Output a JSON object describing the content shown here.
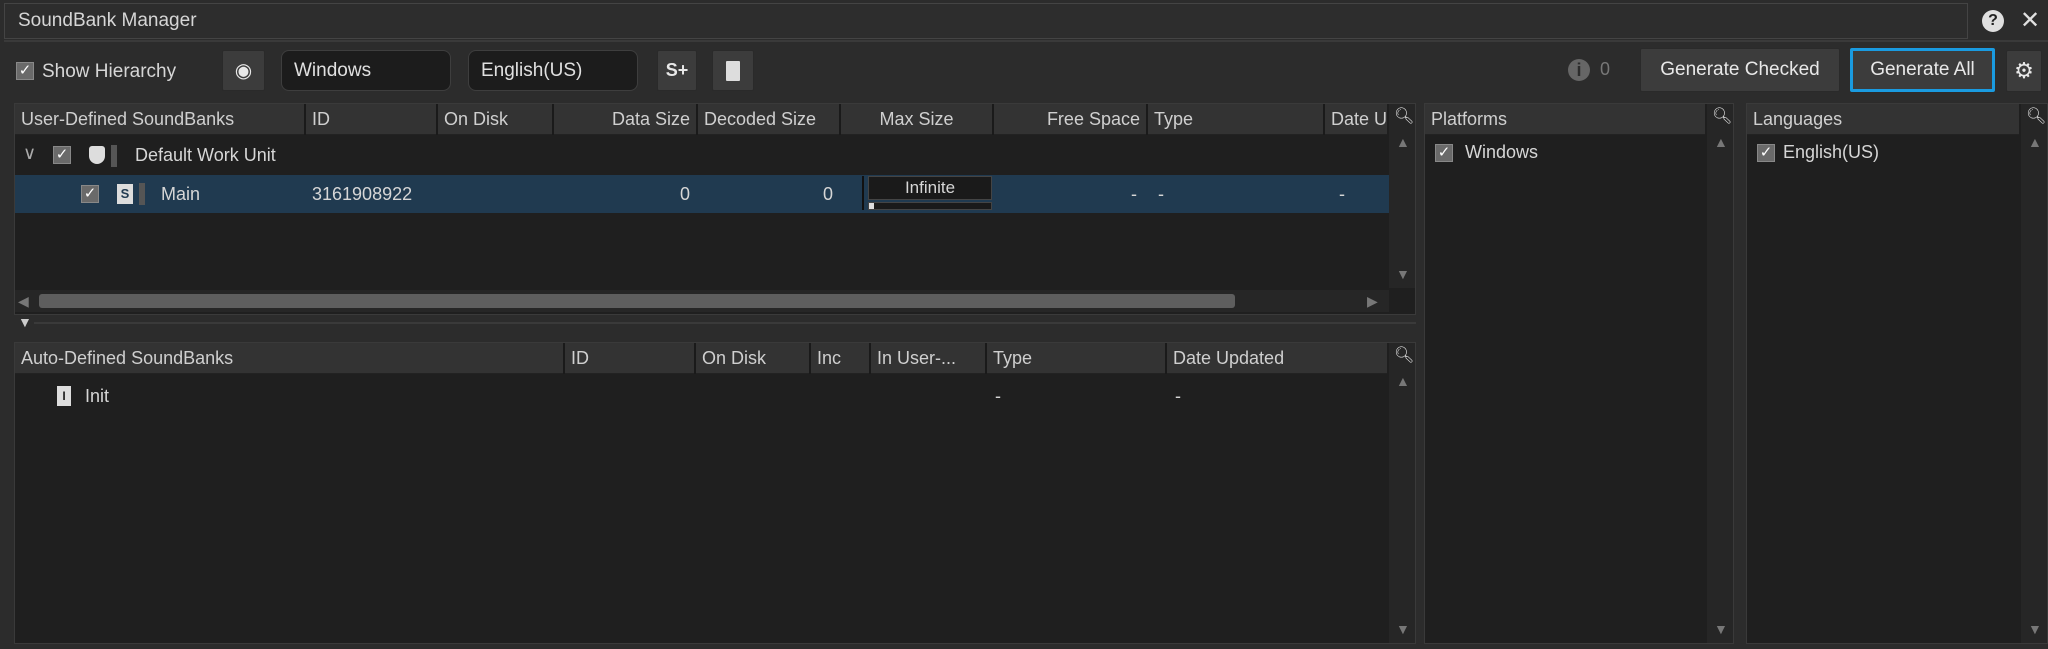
{
  "window": {
    "title": "SoundBank Manager",
    "help_icon": "help-icon",
    "close_icon": "close-icon"
  },
  "toolbar": {
    "show_hierarchy_label": "Show Hierarchy",
    "show_hierarchy_checked": true,
    "platform_value": "Windows",
    "language_value": "English(US)",
    "info_count": "0",
    "generate_checked_label": "Generate Checked",
    "generate_all_label": "Generate All",
    "accent": "#1a9be0"
  },
  "user_table": {
    "columns": [
      "User-Defined SoundBanks",
      "ID",
      "On Disk",
      "Data Size",
      "Decoded Size",
      "Max Size",
      "Free Space",
      "Type",
      "Date U"
    ],
    "rows": [
      {
        "name": "Default Work Unit",
        "checked": true,
        "expanded": true
      },
      {
        "name": "Main",
        "checked": true,
        "id": "3161908922",
        "on_disk": "",
        "data_size": "0",
        "decoded_size": "0",
        "max_size": "Infinite",
        "free_space": "-",
        "type": "-",
        "date": "-",
        "selected": true
      }
    ]
  },
  "auto_table": {
    "columns": [
      "Auto-Defined SoundBanks",
      "ID",
      "On Disk",
      "Inc",
      "In User-...",
      "Type",
      "Date Updated"
    ],
    "rows": [
      {
        "name": "Init",
        "type": "-",
        "date": "-"
      }
    ]
  },
  "platforms": {
    "header": "Platforms",
    "items": [
      {
        "label": "Windows",
        "checked": true
      }
    ]
  },
  "languages": {
    "header": "Languages",
    "items": [
      {
        "label": "English(US)",
        "checked": true
      }
    ]
  }
}
